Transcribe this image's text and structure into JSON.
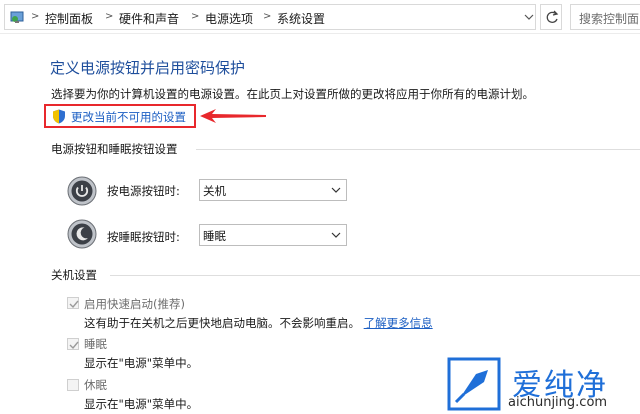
{
  "breadcrumb": {
    "items": [
      "控制面板",
      "硬件和声音",
      "电源选项",
      "系统设置"
    ],
    "separator": ">"
  },
  "search": {
    "placeholder": "搜索控制面"
  },
  "page": {
    "title": "定义电源按钮并启用密码保护",
    "description": "选择要为你的计算机设置的电源设置。在此页上对设置所做的更改将应用于你所有的电源计划。",
    "change_link": "更改当前不可用的设置"
  },
  "power_buttons": {
    "heading": "电源按钮和睡眠按钮设置",
    "rows": [
      {
        "label": "按电源按钮时:",
        "value": "关机"
      },
      {
        "label": "按睡眠按钮时:",
        "value": "睡眠"
      }
    ]
  },
  "shutdown": {
    "heading": "关机设置",
    "options": [
      {
        "label": "启用快速启动(推荐)",
        "checked": true,
        "note": "这有助于在关机之后更快地启动电脑。不会影响重启。",
        "link": "了解更多信息"
      },
      {
        "label": "睡眠",
        "checked": true,
        "note": "显示在\"电源\"菜单中。"
      },
      {
        "label": "休眠",
        "checked": false,
        "note": "显示在\"电源\"菜单中。"
      }
    ]
  },
  "watermark": {
    "brand": "爱纯净",
    "url": "aichunjing.com"
  },
  "colors": {
    "title": "#1e4e9c",
    "link": "#1c5fc3",
    "highlight": "#e8282c",
    "watermark": "#1f6fd8"
  },
  "icons": [
    "control-panel-icon",
    "shield-icon",
    "refresh-icon",
    "power-button-icon",
    "sleep-button-icon"
  ]
}
